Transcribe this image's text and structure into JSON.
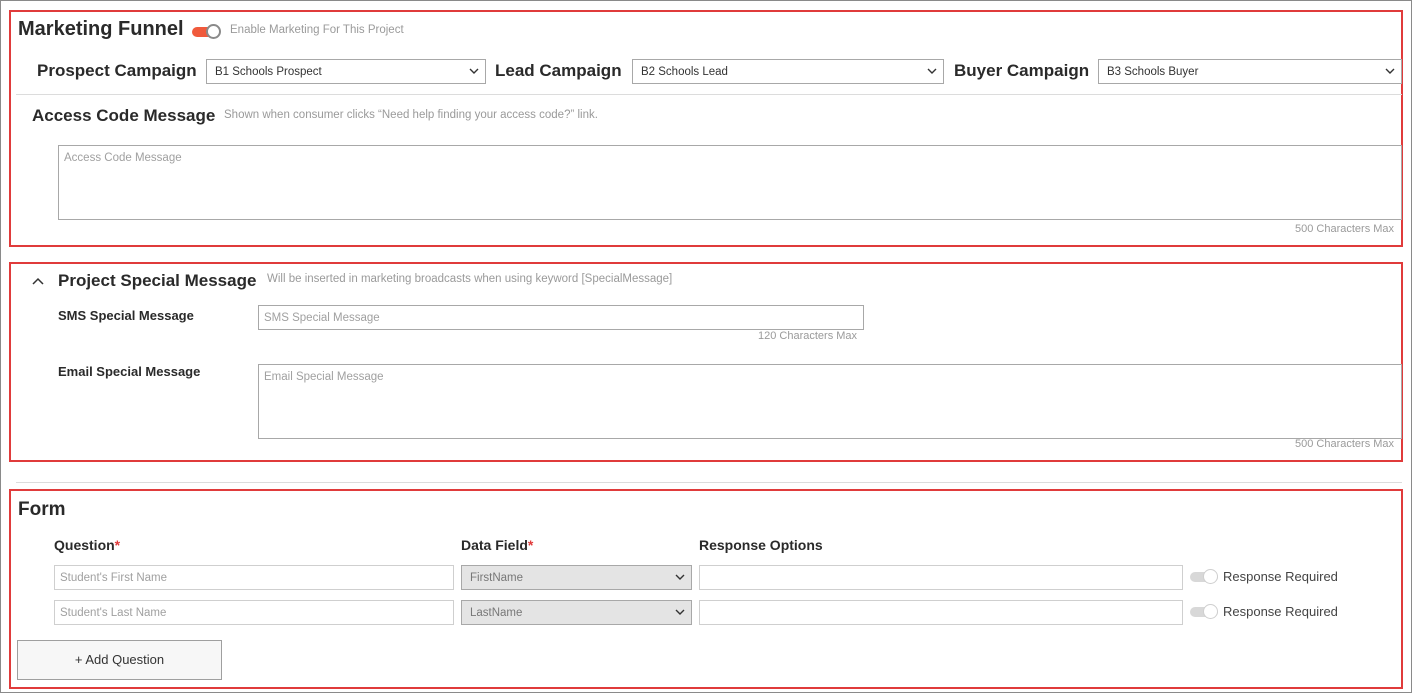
{
  "marketing": {
    "title": "Marketing Funnel",
    "enable_label": "Enable Marketing For This Project",
    "prospect_label": "Prospect Campaign",
    "prospect_value": "B1 Schools Prospect",
    "lead_label": "Lead Campaign",
    "lead_value": "B2 Schools Lead",
    "buyer_label": "Buyer Campaign",
    "buyer_value": "B3 Schools Buyer",
    "access_title": "Access Code Message",
    "access_hint": "Shown when consumer clicks “Need help finding your access code?” link.",
    "access_placeholder": "Access Code Message",
    "access_max": "500 Characters Max"
  },
  "special": {
    "title": "Project Special Message",
    "hint": "Will be inserted in marketing broadcasts when using keyword [SpecialMessage]",
    "sms_label": "SMS Special Message",
    "sms_placeholder": "SMS Special Message",
    "sms_max": "120 Characters Max",
    "email_label": "Email Special Message",
    "email_placeholder": "Email Special Message",
    "email_max": "500 Characters Max"
  },
  "form": {
    "title": "Form",
    "col_question": "Question",
    "col_datafield": "Data Field",
    "col_response": "Response Options",
    "required_marker": "*",
    "rows": [
      {
        "question_placeholder": "Student's First Name",
        "data_field": "FirstName",
        "response_required": "Response Required"
      },
      {
        "question_placeholder": "Student's Last Name",
        "data_field": "LastName",
        "response_required": "Response Required"
      }
    ],
    "add_button": "+ Add Question"
  },
  "colors": {
    "accent": "#f05a3c",
    "highlight": "#e03b3b"
  }
}
